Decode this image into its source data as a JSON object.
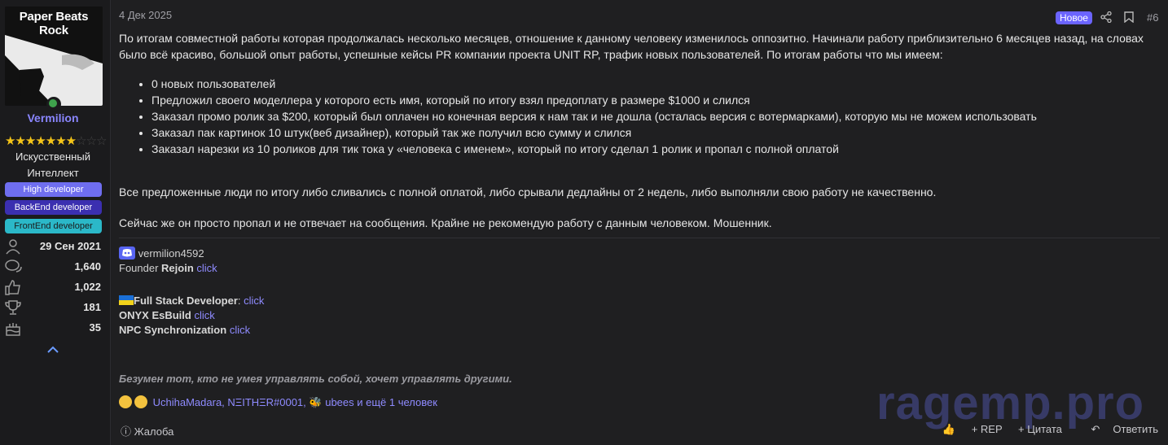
{
  "user": {
    "avatar_text": "Paper Beats Rock",
    "username": "Vermilion",
    "rank_stars": {
      "filled": 7,
      "total": 10
    },
    "title": "Искусственный Интеллект",
    "badges": [
      "High developer",
      "BackEnd developer",
      "FrontEnd developer"
    ],
    "stats": [
      {
        "icon": "user-icon",
        "value": "29 Сен 2021"
      },
      {
        "icon": "messages-icon",
        "value": "1,640"
      },
      {
        "icon": "like-icon",
        "value": "1,022"
      },
      {
        "icon": "trophy-icon",
        "value": "181"
      },
      {
        "icon": "cake-icon",
        "value": "35"
      }
    ]
  },
  "post": {
    "date": "4 Дек 2025",
    "new_label": "Новое",
    "number": "#6",
    "intro": "По итогам совместной работы которая продолжалась несколько месяцев, отношение к данному человеку изменилось оппозитно. Начинали работу приблизительно 6 месяцев назад, на словах было всё красиво, большой опыт работы, успешные кейсы PR компании проекта UNIT RP, трафик новых пользователей. По итогам работы что мы имеем:",
    "list": [
      "0 новых пользователей",
      "Предложил своего моделлера у которого есть имя, который по итогу взял предоплату в размере $1000 и слился",
      "Заказал промо ролик за $200, который был оплачен но конечная версия к нам так и не дошла (осталась версия с вотермарками), которую мы не можем использовать",
      "Заказал пак картинок 10 штук(веб дизайнер), который так же получил всю сумму и слился",
      "Заказал нарезки из 10 роликов для тик тока у «человека с именем», который по итогу сделал 1 ролик и пропал с полной оплатой"
    ],
    "para2": "Все предложенные люди по итогу либо сливались с полной оплатой, либо срывали дедлайны от 2 недель, либо выполняли свою работу не качественно.",
    "para3": "Сейчас же он просто пропал и не отвечает на сообщения. Крайне не рекомендую работу с данным человеком. Мошенник."
  },
  "signature": {
    "discord": "vermilion4592",
    "founder_prefix": "Founder ",
    "founder_name": "Rejoin",
    "click": "click",
    "fullstack": "Full Stack Developer",
    "onyx": "ONYX EsBuild",
    "npc": "NPC Synchronization",
    "quote": "Безумен тот, кто не умея управлять собой, хочет управлять другими."
  },
  "reactions": {
    "users": "UchihaMadara, NΞITHΞR#0001,",
    "more": "ubees и ещё 1 человек"
  },
  "actions": {
    "report": "Жалоба",
    "rep": "+ REP",
    "quote": "+ Цитата",
    "reply": "Ответить"
  },
  "watermark": "ragemp.pro"
}
